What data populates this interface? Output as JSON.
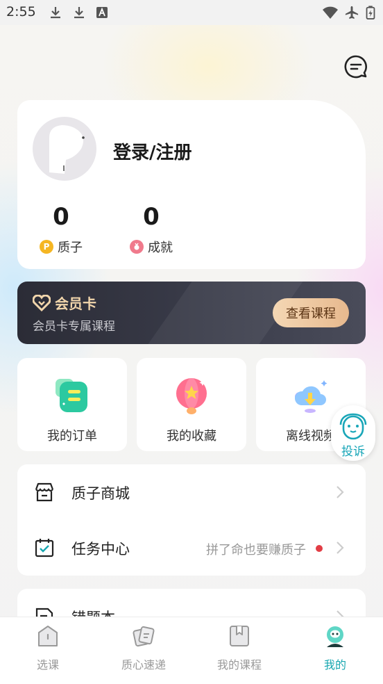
{
  "status_bar": {
    "time": "2:55"
  },
  "profile": {
    "login_label": "登录/注册",
    "stats": [
      {
        "value": "0",
        "label": "质子",
        "icon": "coin-p-icon"
      },
      {
        "value": "0",
        "label": "成就",
        "icon": "medal-icon"
      }
    ]
  },
  "member_card": {
    "title": "会员卡",
    "subtitle": "会员卡专属课程",
    "button": "查看课程"
  },
  "tiles": [
    {
      "label": "我的订单",
      "icon": "order-icon"
    },
    {
      "label": "我的收藏",
      "icon": "balloon-icon"
    },
    {
      "label": "离线视频",
      "icon": "cloud-download-icon"
    }
  ],
  "float_button": {
    "label": "投诉"
  },
  "menu": [
    {
      "label": "质子商城",
      "icon": "shop-icon",
      "hint": ""
    },
    {
      "label": "任务中心",
      "icon": "calendar-check-icon",
      "hint": "拼了命也要赚质子"
    },
    {
      "label": "错题本",
      "icon": "edit-book-icon",
      "hint": ""
    }
  ],
  "bottom_nav": [
    {
      "label": "选课",
      "icon": "home-icon",
      "active": false
    },
    {
      "label": "质心速递",
      "icon": "express-icon",
      "active": false
    },
    {
      "label": "我的课程",
      "icon": "book-icon",
      "active": false
    },
    {
      "label": "我的",
      "icon": "mine-icon",
      "active": true
    }
  ],
  "colors": {
    "accent": "#18a7b0",
    "member_bg": "#2b2c36",
    "member_gold": "#f2d6ac",
    "alert_dot": "#e23d45"
  }
}
